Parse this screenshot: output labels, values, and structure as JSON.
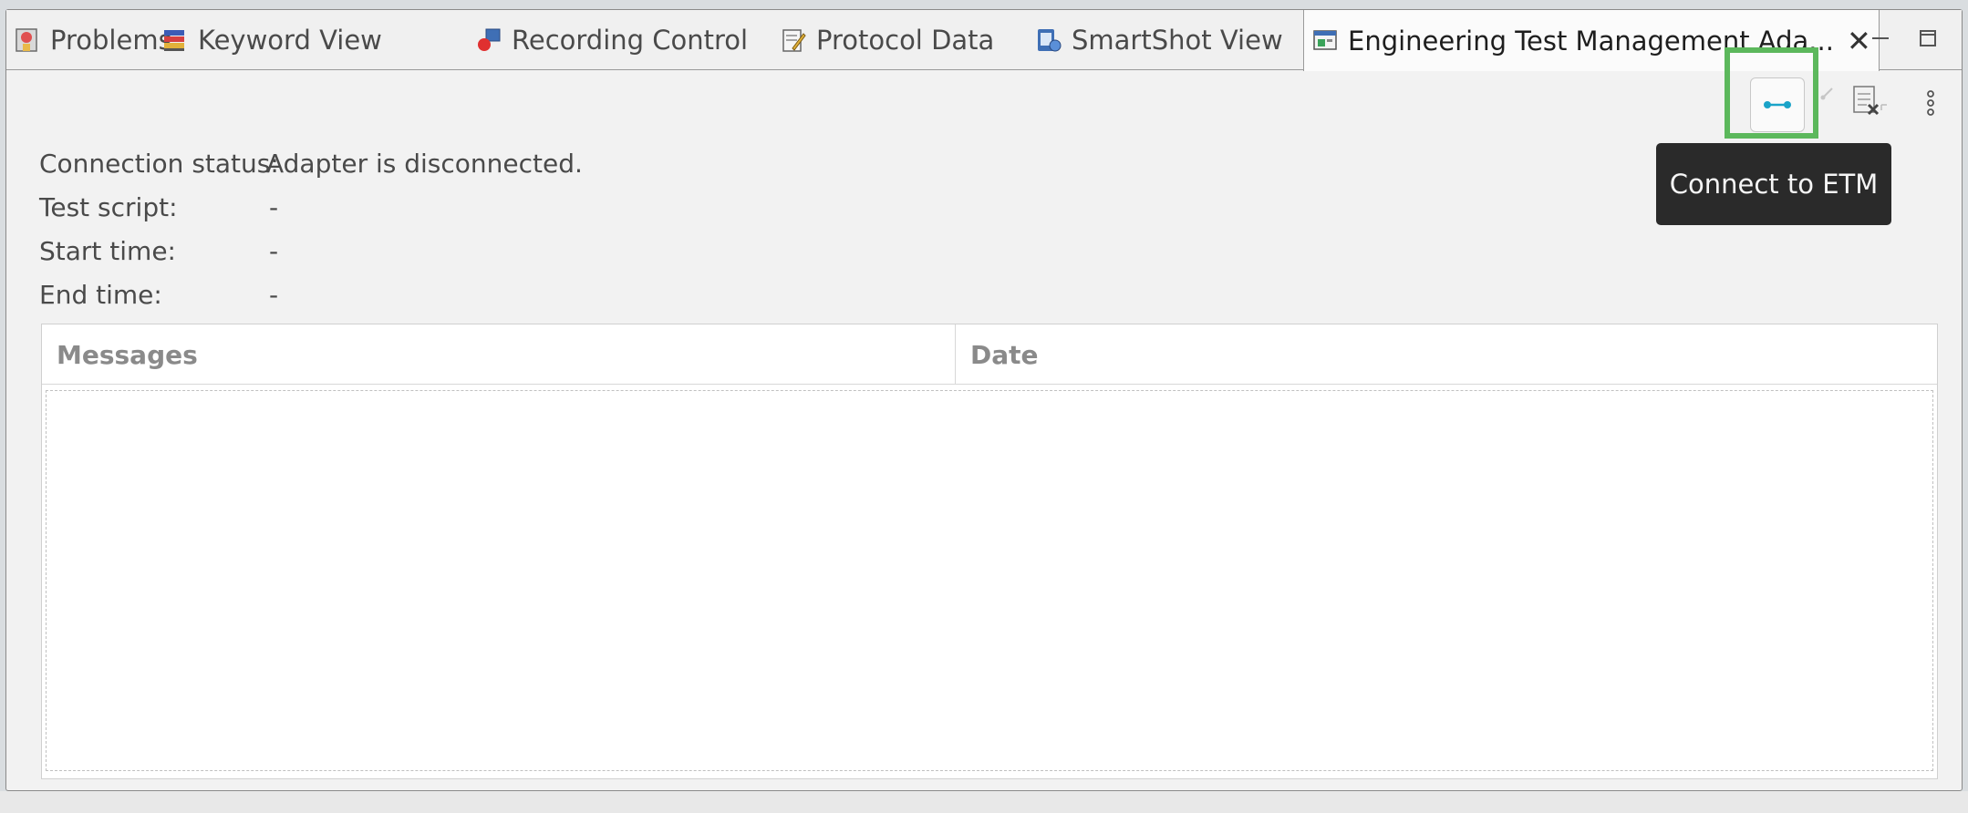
{
  "tabs": [
    {
      "label": "Problems",
      "icon": "problems-icon"
    },
    {
      "label": "Keyword View",
      "icon": "keyword-view-icon"
    },
    {
      "label": "Recording Control",
      "icon": "recording-control-icon"
    },
    {
      "label": "Protocol Data",
      "icon": "protocol-data-icon"
    },
    {
      "label": "SmartShot View",
      "icon": "smartshot-view-icon"
    },
    {
      "label": "Engineering Test Management Ada...",
      "icon": "etm-adapter-icon",
      "active": true
    }
  ],
  "tooltip": {
    "text": "Connect to ETM"
  },
  "info": {
    "connection_status_label": "Connection status:",
    "connection_status_value": "Adapter is disconnected.",
    "test_script_label": "Test script:",
    "test_script_value": "-",
    "start_time_label": "Start time:",
    "start_time_value": "-",
    "end_time_label": "End time:",
    "end_time_value": "-"
  },
  "table": {
    "columns": [
      "Messages",
      "Date"
    ],
    "rows": []
  },
  "colors": {
    "highlight": "#5cb85c",
    "connect_icon": "#1aa3c8",
    "tooltip_bg": "#2a2a2a"
  }
}
